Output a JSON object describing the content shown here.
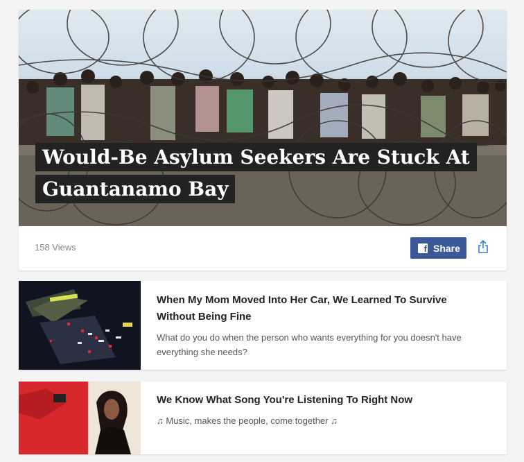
{
  "feature": {
    "headline": "Would-Be Asylum Seekers Are Stuck At Guantanamo Bay",
    "views": "158 Views",
    "share_label": "Share",
    "share_brand_color": "#3b5998"
  },
  "stories": [
    {
      "title": "When My Mom Moved Into Her Car, We Learned To Survive Without Being Fine",
      "description": "What do you do when the person who wants everything for you doesn't have everything she needs?"
    },
    {
      "title": "We Know What Song You're Listening To Right Now",
      "description": "♫ Music, makes the people, come together ♫"
    }
  ]
}
